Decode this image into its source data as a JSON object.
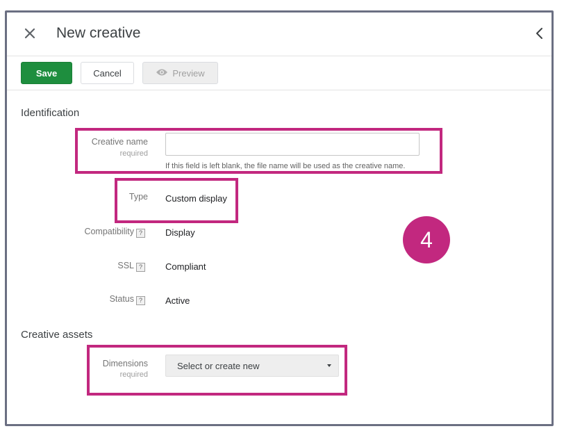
{
  "header": {
    "title": "New creative",
    "close_icon": "close-icon",
    "collapse_icon": "chevron-left-icon"
  },
  "toolbar": {
    "save_label": "Save",
    "cancel_label": "Cancel",
    "preview_label": "Preview",
    "preview_icon": "eye-icon"
  },
  "identification": {
    "section_title": "Identification",
    "creative_name": {
      "label": "Creative name",
      "sublabel": "required",
      "value": "",
      "hint": "If this field is left blank, the file name will be used as the creative name."
    },
    "type": {
      "label": "Type",
      "value": "Custom display"
    },
    "compatibility": {
      "label": "Compatibility",
      "help": "?",
      "value": "Display"
    },
    "ssl": {
      "label": "SSL",
      "help": "?",
      "value": "Compliant"
    },
    "status": {
      "label": "Status",
      "help": "?",
      "value": "Active"
    }
  },
  "creative_assets": {
    "section_title": "Creative assets",
    "dimensions": {
      "label": "Dimensions",
      "sublabel": "required",
      "selected": "Select or create new"
    }
  },
  "annotation": {
    "step_number": "4",
    "color": "#c2287f"
  },
  "colors": {
    "save_button": "#1e8e3e",
    "highlight": "#c2287f",
    "frame_border": "#6b6f82"
  }
}
